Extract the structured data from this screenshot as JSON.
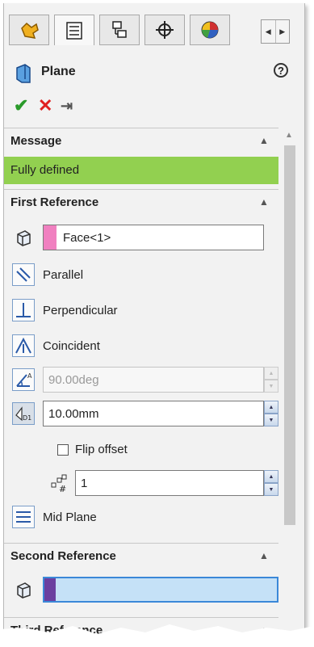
{
  "tabs": [
    {
      "icon": "feature-manager-icon"
    },
    {
      "icon": "property-manager-icon"
    },
    {
      "icon": "configuration-manager-icon"
    },
    {
      "icon": "dimxpert-manager-icon"
    },
    {
      "icon": "display-manager-icon"
    }
  ],
  "header": {
    "title": "Plane",
    "help_icon": "?"
  },
  "actions": {
    "ok": "✔",
    "cancel": "✕",
    "pin": "⇥"
  },
  "message": {
    "title": "Message",
    "text": "Fully defined",
    "color": "#92d050"
  },
  "first_reference": {
    "title": "First Reference",
    "selection": "Face<1>",
    "selection_color": "#f080c0",
    "options": {
      "parallel": "Parallel",
      "perpendicular": "Perpendicular",
      "coincident": "Coincident",
      "angle": "90.00deg",
      "offset": "10.00mm",
      "flip_offset": "Flip offset",
      "instances": "1",
      "mid_plane": "Mid Plane"
    }
  },
  "second_reference": {
    "title": "Second Reference",
    "selection": "",
    "selection_color": "#6b3fa0",
    "field_color": "#c5e1f7"
  },
  "third_reference": {
    "title": "Third Reference"
  }
}
